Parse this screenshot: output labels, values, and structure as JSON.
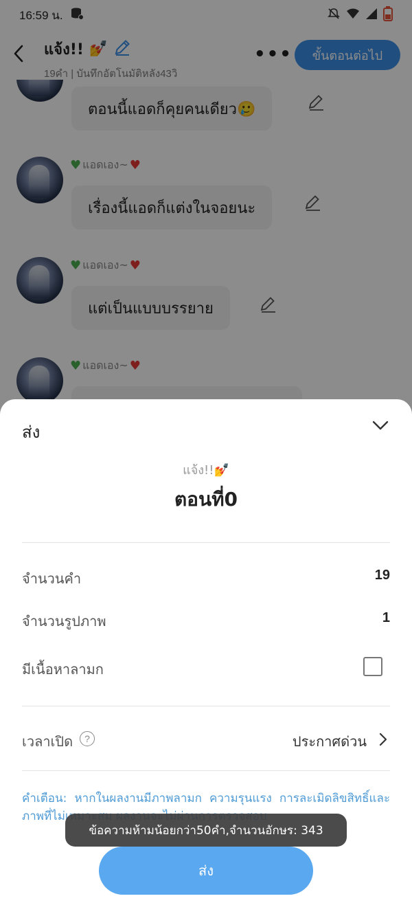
{
  "status_bar": {
    "time": "16:59 น.",
    "battery_color": "#e5533a"
  },
  "header": {
    "title": "แจ้ง!!",
    "title_emoji": "💅",
    "subtitle": "19คำ | บันทึกอัตโนมัติหลัง43วิ",
    "more_label": "•••",
    "next_button": "ขั้นตอนต่อไป"
  },
  "messages": [
    {
      "sender": "",
      "text": "ตอนนี้แอดก็คุยคนเดียว🥲"
    },
    {
      "sender": "แอดเอง~",
      "text": "เรื่องนี้แอดก็แต่งในจอยนะ"
    },
    {
      "sender": "แอดเอง~",
      "text": "แต่เป็นแบบบรรยาย"
    },
    {
      "sender": "แอดเอง~",
      "text": ""
    }
  ],
  "sheet": {
    "title": "ส่ง",
    "work_name": "แจ้ง!!💅",
    "episode": "ตอนที่0",
    "word_count_label": "จำนวนคำ",
    "word_count_value": "19",
    "image_count_label": "จำนวนรูปภาพ",
    "image_count_value": "1",
    "mature_label": "มีเนื้อหาลามก",
    "mature_checked": false,
    "publish_time_label": "เวลาเปิด",
    "publish_time_help": "?",
    "publish_time_value": "ประกาศด่วน",
    "warning": "คำเตือน: หากในผลงานมีภาพลามก ความรุนแรง การละเมิดลิขสิทธิ์และภาพที่ไม่เหมาะสม ผลงานจะไม่ผ่านการตรวจสอบ",
    "send_button": "ส่ง"
  },
  "toast": "ข้อความห้ามน้อยกว่า50คำ,จำนวนอักษร: 343",
  "colors": {
    "accent": "#3b8fe8",
    "send_button": "#5aa8f0",
    "warning_text": "#4f9bd6"
  }
}
